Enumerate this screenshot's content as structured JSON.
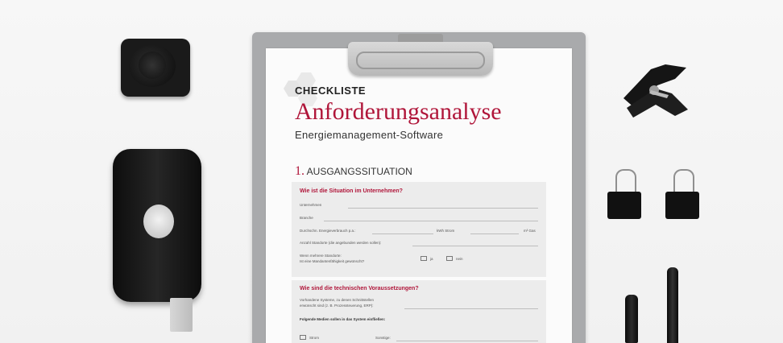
{
  "document": {
    "checklist_label": "CHECKLISTE",
    "title": "Anforderungsanalyse",
    "subtitle": "Energiemanagement-Software",
    "section1_number": "1.",
    "section1_title": "AUSGANGSSITUATION",
    "block1": {
      "question": "Wie ist die Situation im Unternehmen?",
      "fields": [
        "Unternehmen",
        "Branche",
        "Durchschn. Energieverbrauch p.a.:",
        "Anzahl Standorte (die angebunden werden sollen):",
        "Wenn mehrere Standorte:",
        "Ist eine Mandantenfähigkeit gewünscht?"
      ],
      "unit_strom": "kWh Strom",
      "unit_gas": "m³ Gas",
      "option_yes": "ja",
      "option_no": "nein"
    },
    "block2": {
      "question": "Wie sind die technischen Voraussetzungen?",
      "field1_line1": "Vorhandene Systeme, zu denen Schnittstellen",
      "field1_line2": "erwünscht sind (z. B. Prozessteuerung, ERP):",
      "media_prompt": "Folgende Medien sollen in das System einfließen:",
      "media_strom": "Strom",
      "media_sonstige": "Sonstige:"
    }
  }
}
